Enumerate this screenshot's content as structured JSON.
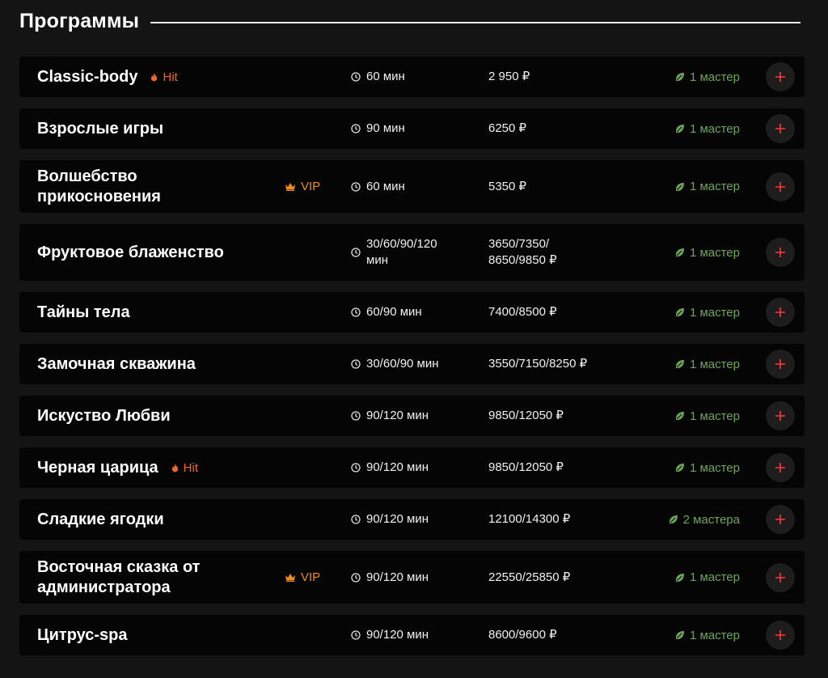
{
  "header": {
    "title": "Программы"
  },
  "colors": {
    "background": "#141414",
    "row": "#050505",
    "accent_hit": "#f3662b",
    "accent_vip": "#ea8c1e",
    "masters": "#6da65a",
    "add": "#ff3838"
  },
  "programs": [
    {
      "name": "Classic-body",
      "badge": "Hit",
      "badge_type": "hit",
      "duration": "60 мин",
      "price": "2 950 ₽",
      "masters": "1 мастер"
    },
    {
      "name": "Взрослые игры",
      "badge": "",
      "badge_type": "",
      "duration": "90 мин",
      "price": "6250 ₽",
      "masters": "1 мастер"
    },
    {
      "name": "Волшебство прикосновения",
      "badge": "VIP",
      "badge_type": "vip",
      "duration": "60 мин",
      "price": "5350 ₽",
      "masters": "1 мастер"
    },
    {
      "name": "Фруктовое блаженство",
      "badge": "",
      "badge_type": "",
      "duration": "30/60/90/120 мин",
      "price": "3650/7350/ 8650/9850 ₽",
      "masters": "1 мастер"
    },
    {
      "name": "Тайны тела",
      "badge": "",
      "badge_type": "",
      "duration": "60/90 мин",
      "price": "7400/8500 ₽",
      "masters": "1 мастер"
    },
    {
      "name": "Замочная скважина",
      "badge": "",
      "badge_type": "",
      "duration": "30/60/90 мин",
      "price": "3550/7150/8250 ₽",
      "masters": "1 мастер"
    },
    {
      "name": "Искуство Любви",
      "badge": "",
      "badge_type": "",
      "duration": "90/120 мин",
      "price": "9850/12050 ₽",
      "masters": "1 мастер"
    },
    {
      "name": "Черная царица",
      "badge": "Hit",
      "badge_type": "hit",
      "duration": "90/120 мин",
      "price": "9850/12050 ₽",
      "masters": "1 мастер"
    },
    {
      "name": "Сладкие ягодки",
      "badge": "",
      "badge_type": "",
      "duration": "90/120 мин",
      "price": "12100/14300 ₽",
      "masters": "2 мастера"
    },
    {
      "name": "Восточная сказка от администратора",
      "badge": "VIP",
      "badge_type": "vip",
      "duration": "90/120 мин",
      "price": "22550/25850 ₽",
      "masters": "1 мастер"
    },
    {
      "name": "Цитрус-spa",
      "badge": "",
      "badge_type": "",
      "duration": "90/120 мин",
      "price": "8600/9600 ₽",
      "masters": "1 мастер"
    }
  ]
}
